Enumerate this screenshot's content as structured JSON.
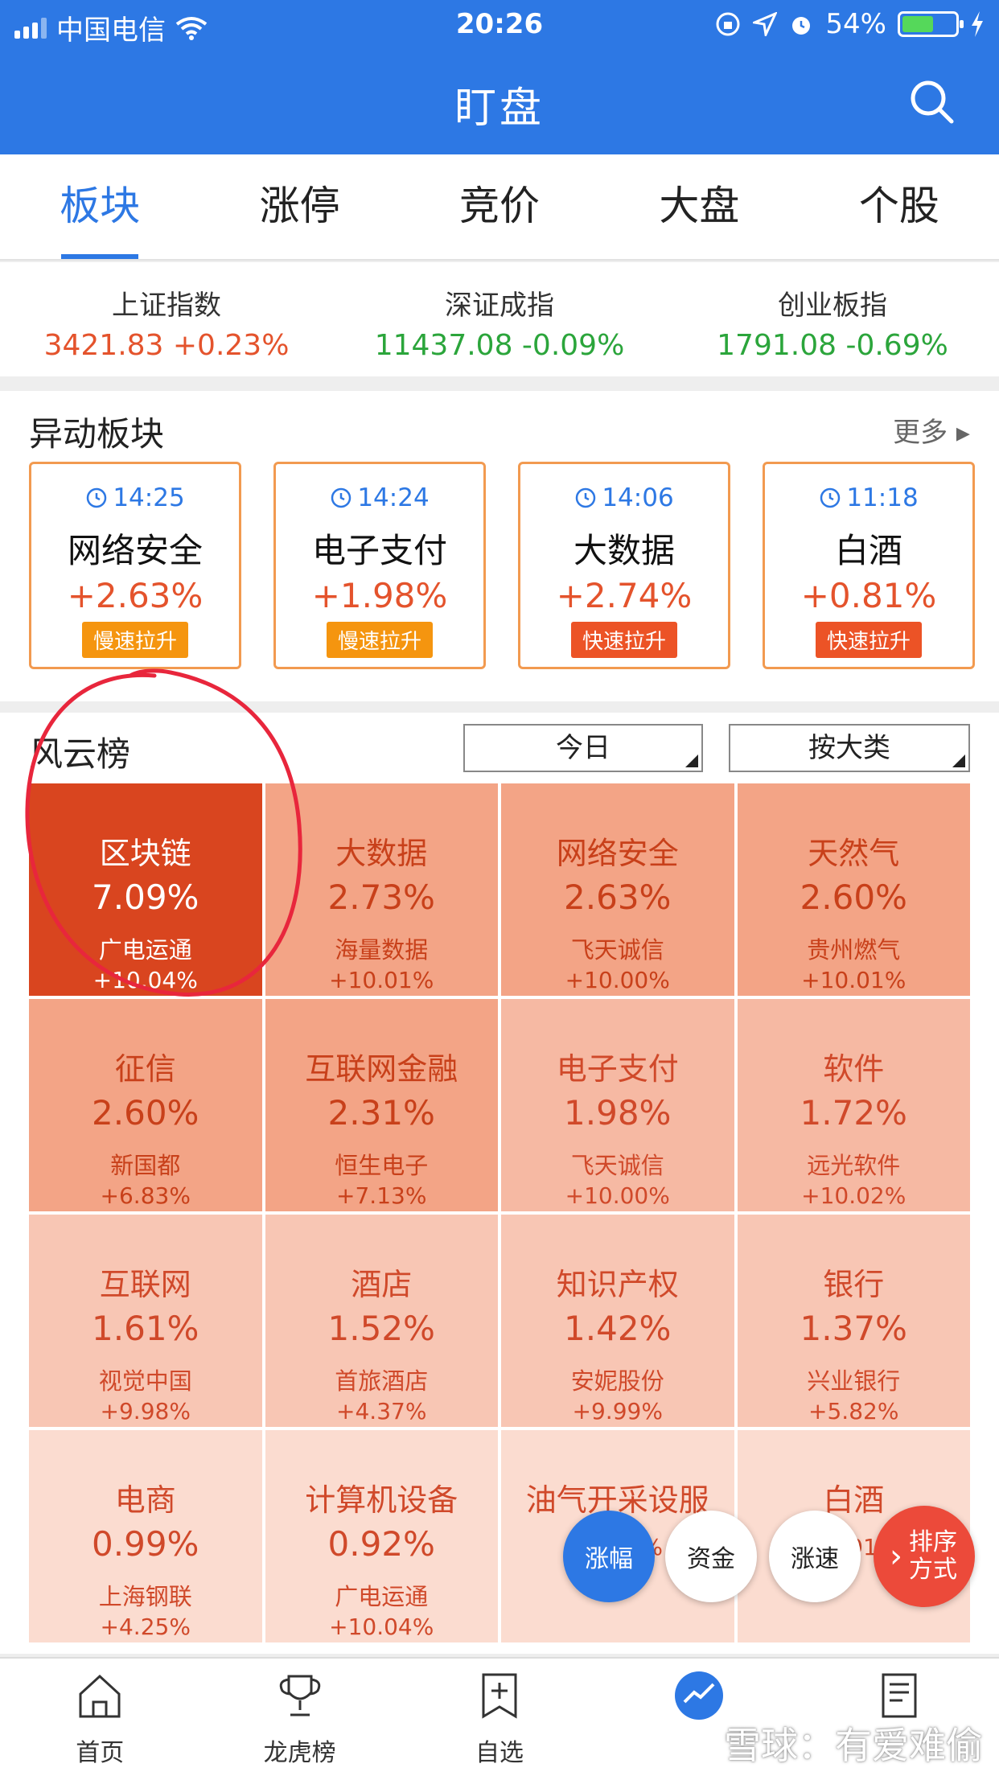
{
  "status_bar": {
    "carrier": "中国电信",
    "time": "20:26",
    "battery": "54%",
    "battery_level": 0.54
  },
  "header": {
    "title": "盯盘",
    "search_icon": "search-icon"
  },
  "tabs": [
    {
      "label": "板块",
      "active": true
    },
    {
      "label": "涨停",
      "active": false
    },
    {
      "label": "竞价",
      "active": false
    },
    {
      "label": "大盘",
      "active": false
    },
    {
      "label": "个股",
      "active": false
    }
  ],
  "indices": [
    {
      "name": "上证指数",
      "value": "3421.83 +0.23%",
      "color": "#e4532c"
    },
    {
      "name": "深证成指",
      "value": "11437.08 -0.09%",
      "color": "#2ba53b"
    },
    {
      "name": "创业板指",
      "value": "1791.08 -0.69%",
      "color": "#2ba53b"
    }
  ],
  "alert_section": {
    "title": "异动板块",
    "more": "更多",
    "cards": [
      {
        "time": "14:25",
        "name": "网络安全",
        "pct": "+2.63%",
        "tag": "慢速拉升",
        "tag_color": "#f5950f"
      },
      {
        "time": "14:24",
        "name": "电子支付",
        "pct": "+1.98%",
        "tag": "慢速拉升",
        "tag_color": "#f5950f"
      },
      {
        "time": "14:06",
        "name": "大数据",
        "pct": "+2.74%",
        "tag": "快速拉升",
        "tag_color": "#ec5326"
      },
      {
        "time": "11:18",
        "name": "白酒",
        "pct": "+0.81%",
        "tag": "快速拉升",
        "tag_color": "#ec5326"
      }
    ]
  },
  "heatmap": {
    "title": "风云榜",
    "period_select": "今日",
    "category_select": "按大类",
    "cells": [
      {
        "name": "区块链",
        "pct": "7.09%",
        "stock": "广电运通",
        "gain": "+10.04%",
        "bg": "#d9451f",
        "fg": "#ffffff"
      },
      {
        "name": "大数据",
        "pct": "2.73%",
        "stock": "海量数据",
        "gain": "+10.01%",
        "bg": "#f3a486",
        "fg": "#c8401a"
      },
      {
        "name": "网络安全",
        "pct": "2.63%",
        "stock": "飞天诚信",
        "gain": "+10.00%",
        "bg": "#f3a486",
        "fg": "#c8401a"
      },
      {
        "name": "天然气",
        "pct": "2.60%",
        "stock": "贵州燃气",
        "gain": "+10.01%",
        "bg": "#f3a486",
        "fg": "#c8401a"
      },
      {
        "name": "征信",
        "pct": "2.60%",
        "stock": "新国都",
        "gain": "+6.83%",
        "bg": "#f3a486",
        "fg": "#c8401a"
      },
      {
        "name": "互联网金融",
        "pct": "2.31%",
        "stock": "恒生电子",
        "gain": "+7.13%",
        "bg": "#f3a486",
        "fg": "#c8401a"
      },
      {
        "name": "电子支付",
        "pct": "1.98%",
        "stock": "飞天诚信",
        "gain": "+10.00%",
        "bg": "#f6b9a3",
        "fg": "#d0492a"
      },
      {
        "name": "软件",
        "pct": "1.72%",
        "stock": "远光软件",
        "gain": "+10.02%",
        "bg": "#f6b9a3",
        "fg": "#d0492a"
      },
      {
        "name": "互联网",
        "pct": "1.61%",
        "stock": "视觉中国",
        "gain": "+9.98%",
        "bg": "#f8c6b4",
        "fg": "#d0492a"
      },
      {
        "name": "酒店",
        "pct": "1.52%",
        "stock": "首旅酒店",
        "gain": "+4.37%",
        "bg": "#f8c6b4",
        "fg": "#d0492a"
      },
      {
        "name": "知识产权",
        "pct": "1.42%",
        "stock": "安妮股份",
        "gain": "+9.99%",
        "bg": "#f8c6b4",
        "fg": "#d0492a"
      },
      {
        "name": "银行",
        "pct": "1.37%",
        "stock": "兴业银行",
        "gain": "+5.82%",
        "bg": "#f8c6b4",
        "fg": "#d0492a"
      },
      {
        "name": "电商",
        "pct": "0.99%",
        "stock": "上海钢联",
        "gain": "+4.25%",
        "bg": "#fbdcd0",
        "fg": "#d0492a"
      },
      {
        "name": "计算机设备",
        "pct": "0.92%",
        "stock": "广电运通",
        "gain": "+10.04%",
        "bg": "#fbdcd0",
        "fg": "#d0492a"
      },
      {
        "name": "油气开采设服",
        "pct": "",
        "stock": "",
        "gain": "+4.15%",
        "bg": "#fbdcd0",
        "fg": "#d0492a"
      },
      {
        "name": "白酒",
        "pct": "",
        "stock": "",
        "gain": "+5.91%",
        "bg": "#fbdcd0",
        "fg": "#d0492a"
      }
    ]
  },
  "floating_buttons": [
    {
      "label": "涨幅",
      "active": true
    },
    {
      "label": "资金",
      "active": false
    },
    {
      "label": "涨速",
      "active": false
    },
    {
      "label": "排序方式",
      "active": false
    }
  ],
  "bottom_nav": [
    {
      "label": "首页",
      "icon": "home-icon"
    },
    {
      "label": "龙虎榜",
      "icon": "trophy-icon"
    },
    {
      "label": "自选",
      "icon": "add-favorite-icon"
    },
    {
      "label": "",
      "icon": "chart-icon"
    },
    {
      "label": "",
      "icon": "news-icon"
    }
  ],
  "watermark": "雪球：有爱难偷",
  "colors": {
    "brand_blue": "#2d78e4",
    "up_red": "#e4532c",
    "down_green": "#2ba53b",
    "annotation_red": "#e8263c"
  }
}
